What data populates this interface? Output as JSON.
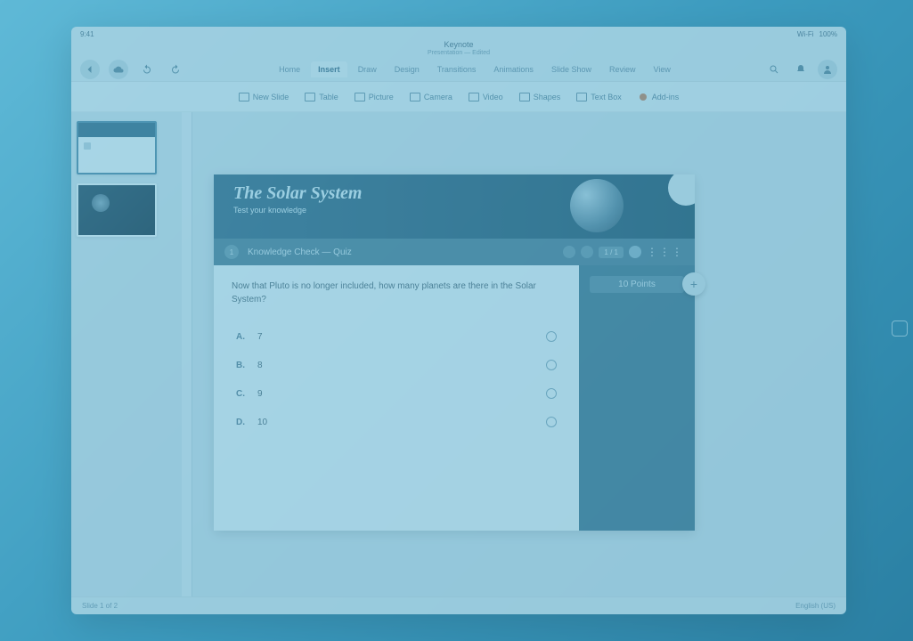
{
  "statusbar": {
    "time": "9:41",
    "network": "Wi-Fi",
    "battery": "100%"
  },
  "titlebar": {
    "title": "Keynote",
    "subtitle": "Presentation — Edited"
  },
  "ribbon": {
    "tabs": [
      "Home",
      "Insert",
      "Draw",
      "Design",
      "Transitions",
      "Animations",
      "Slide Show",
      "Review",
      "View"
    ],
    "active_index": 1,
    "right_icons": [
      "search-icon",
      "bell-icon",
      "account-icon"
    ]
  },
  "insert_items": [
    {
      "icon": "slide",
      "label": "New Slide"
    },
    {
      "icon": "table",
      "label": "Table"
    },
    {
      "icon": "picture",
      "label": "Picture"
    },
    {
      "icon": "camera",
      "label": "Camera"
    },
    {
      "icon": "video",
      "label": "Video"
    },
    {
      "icon": "shape",
      "label": "Shapes"
    },
    {
      "icon": "text",
      "label": "Text Box"
    },
    {
      "icon": "addin",
      "label": "Add-ins"
    }
  ],
  "thumbnails": [
    {
      "index": 1,
      "active": true,
      "kind": "quiz"
    },
    {
      "index": 2,
      "active": false,
      "kind": "space"
    }
  ],
  "slide": {
    "header_title": "The Solar System",
    "header_subtitle": "Test your knowledge",
    "question_bar_title": "Knowledge Check — Quiz",
    "question_number": "1",
    "question_text": "Now that Pluto is no longer included, how many planets are there in the Solar System?",
    "options": [
      {
        "letter": "A.",
        "value": "7"
      },
      {
        "letter": "B.",
        "value": "8"
      },
      {
        "letter": "C.",
        "value": "9"
      },
      {
        "letter": "D.",
        "value": "10"
      }
    ],
    "points_label": "10 Points",
    "more_label": "⋮⋮⋮"
  },
  "footer": {
    "left": "Slide 1 of 2",
    "right": "English (US)"
  },
  "colors": {
    "accent": "#2d5a75",
    "bg": "#dfe9ee"
  }
}
